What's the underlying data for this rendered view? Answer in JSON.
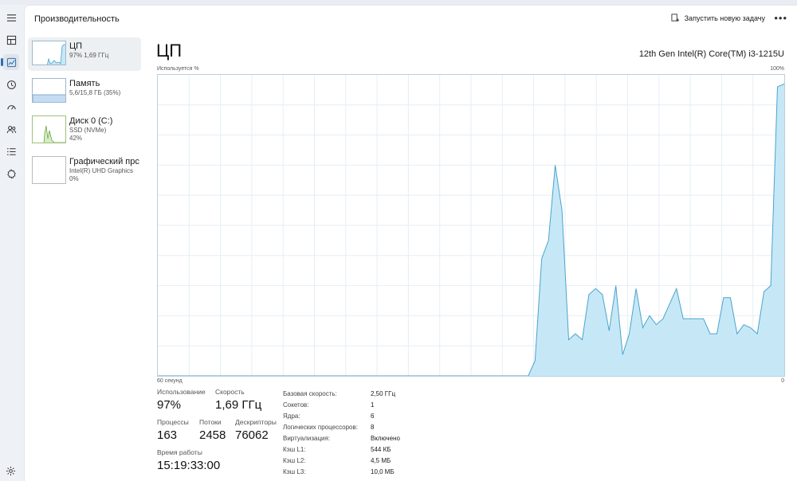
{
  "header": {
    "title": "Производительность",
    "run_task_label": "Запустить новую задачу",
    "more_label": "•••"
  },
  "devices": [
    {
      "name": "ЦП",
      "line1": "97%  1,69 ГГц",
      "line2": ""
    },
    {
      "name": "Память",
      "line1": "5,6/15,8 ГБ (35%)",
      "line2": ""
    },
    {
      "name": "Диск 0 (C:)",
      "line1": "SSD (NVMe)",
      "line2": "42%"
    },
    {
      "name": "Графический прс",
      "line1": "Intel(R) UHD Graphics",
      "line2": "0%"
    }
  ],
  "cpu": {
    "title": "ЦП",
    "model": "12th Gen Intel(R) Core(TM) i3-1215U",
    "usage_axis_label": "Используется %",
    "max_label": "100%",
    "time_label": "60 секунд",
    "min_label": "0"
  },
  "stats": {
    "usage": {
      "label": "Использование",
      "value": "97%"
    },
    "speed": {
      "label": "Скорость",
      "value": "1,69 ГГц"
    },
    "processes": {
      "label": "Процессы",
      "value": "163"
    },
    "threads": {
      "label": "Потоки",
      "value": "2458"
    },
    "handles": {
      "label": "Дескрипторы",
      "value": "76062"
    },
    "uptime": {
      "label": "Время работы",
      "value": "15:19:33:00"
    }
  },
  "properties": [
    {
      "k": "Базовая скорость:",
      "v": "2,50 ГГц"
    },
    {
      "k": "Сокетов:",
      "v": "1"
    },
    {
      "k": "Ядра:",
      "v": "6"
    },
    {
      "k": "Логических процессоров:",
      "v": "8"
    },
    {
      "k": "Виртуализация:",
      "v": "Включено"
    },
    {
      "k": "Кэш L1:",
      "v": "544 КБ"
    },
    {
      "k": "Кэш L2:",
      "v": "4,5 МБ"
    },
    {
      "k": "Кэш L3:",
      "v": "10,0 МБ"
    }
  ],
  "colors": {
    "cpu_fill": "#c6e8f6",
    "cpu_line": "#4aa3cf",
    "accent": "#2a6fb6"
  },
  "chart_data": {
    "type": "area",
    "x_range_seconds": [
      0,
      60
    ],
    "ylim": [
      0,
      100
    ],
    "values": [
      0,
      0,
      0,
      0,
      0,
      0,
      0,
      0,
      0,
      0,
      0,
      0,
      0,
      0,
      0,
      0,
      0,
      0,
      0,
      0,
      0,
      0,
      0,
      0,
      0,
      0,
      0,
      0,
      0,
      0,
      0,
      0,
      0,
      0,
      0,
      0,
      0,
      0,
      0,
      0,
      0,
      0,
      0,
      0,
      0,
      0,
      0,
      0,
      0,
      0,
      0,
      0,
      0,
      0,
      0,
      0,
      5,
      39,
      45,
      70,
      55,
      12,
      14,
      12,
      27,
      29,
      27,
      15,
      30,
      7,
      14,
      29,
      16,
      20,
      17,
      19,
      24,
      29,
      19,
      19,
      19,
      19,
      14,
      14,
      26,
      26,
      14,
      17,
      16,
      14,
      28,
      30,
      96,
      97
    ]
  }
}
